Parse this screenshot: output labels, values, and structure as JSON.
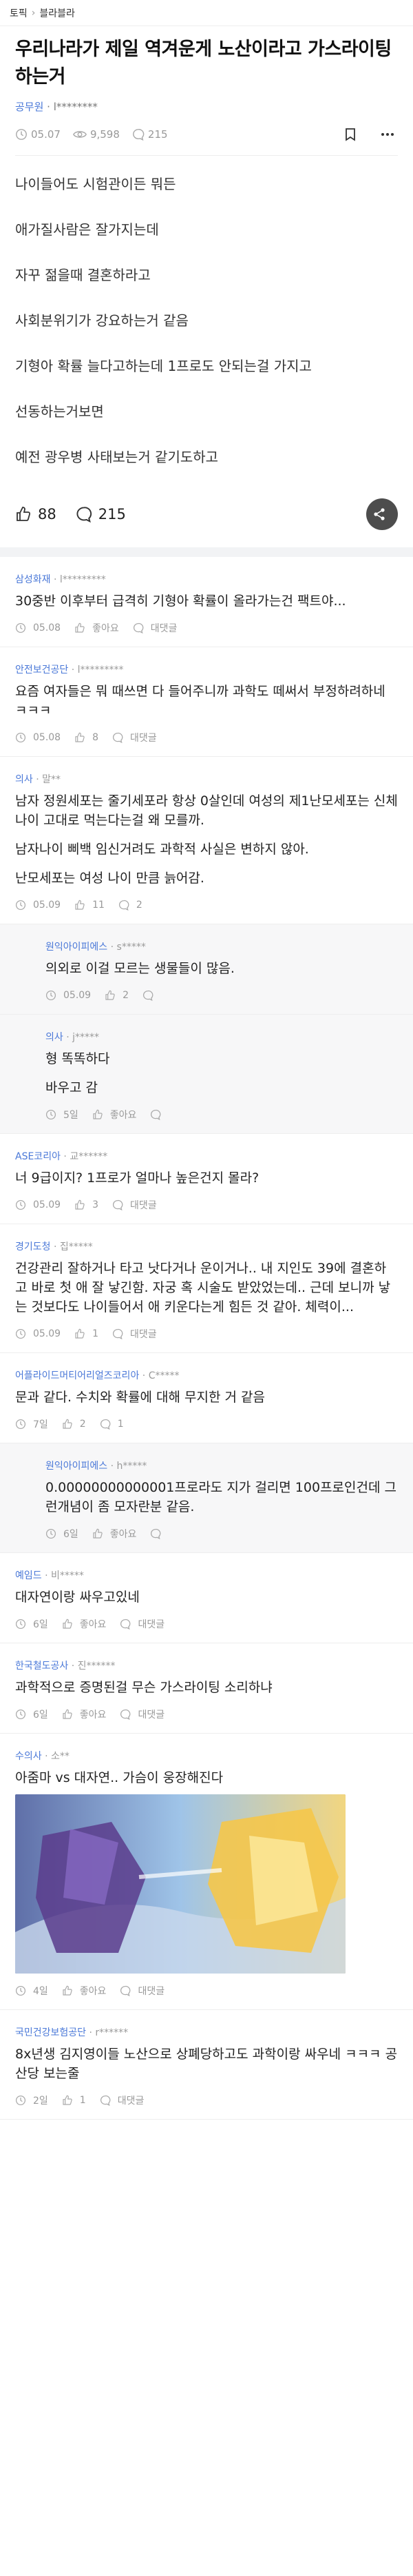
{
  "breadcrumb": {
    "root": "토픽",
    "sep": "›",
    "board": "블라블라"
  },
  "post": {
    "title": "우리나라가 제일 역겨운게 노산이라고 가스라이팅하는거",
    "author_company": "공무원",
    "author_sep": " · ",
    "author_name": "l********",
    "date": "05.07",
    "views": "9,598",
    "comments": "215",
    "body": [
      "나이들어도 시험관이든 뭐든",
      "애가질사람은 잘가지는데",
      "자꾸 젊을때 결혼하라고",
      "사회분위기가 강요하는거 같음",
      "기형아 확률 늘다고하는데 1프로도 안되는걸 가지고",
      "선동하는거보면",
      "예전 광우병 사태보는거 같기도하고"
    ],
    "likes": "88",
    "comment_count": "215"
  },
  "labels": {
    "like": "좋아요",
    "reply": "대댓글"
  },
  "comments": [
    {
      "company": "삼성화재",
      "name": "l*********",
      "text": [
        "30중반 이후부터 급격히 기형아 확률이 올라가는건 팩트야..."
      ],
      "date": "05.08",
      "likes": "좋아요",
      "replies": "대댓글",
      "reply": false
    },
    {
      "company": "안전보건공단",
      "name": "l*********",
      "text": [
        "요즘 여자들은 뭐 때쓰면 다 들어주니까 과학도 떼써서 부정하려하네 ㅋㅋㅋ"
      ],
      "date": "05.08",
      "likes": "8",
      "replies": "대댓글",
      "reply": false
    },
    {
      "company": "의사",
      "name": "말**",
      "text": [
        "남자 정원세포는 줄기세포라 항상 0살인데 여성의 제1난모세포는 신체나이 고대로 먹는다는걸 왜 모를까.",
        "남자나이 삐백 임신거려도 과학적 사실은 변하지 않아.",
        "난모세포는 여성 나이 만큼 늙어감."
      ],
      "date": "05.09",
      "likes": "11",
      "replies": "2",
      "reply": false
    },
    {
      "company": "원익아이피에스",
      "name": "s*****",
      "text": [
        "의외로 이걸 모르는 생물들이 많음."
      ],
      "date": "05.09",
      "likes": "2",
      "replies": "",
      "reply": true
    },
    {
      "company": "의사",
      "name": "j*****",
      "text": [
        "형 똑똑하다",
        "바우고 감"
      ],
      "date": "5일",
      "likes": "좋아요",
      "replies": "",
      "reply": true
    },
    {
      "company": "ASE코리아",
      "name": "교******",
      "text": [
        "너 9급이지? 1프로가 얼마나 높은건지 몰라?"
      ],
      "date": "05.09",
      "likes": "3",
      "replies": "대댓글",
      "reply": false
    },
    {
      "company": "경기도청",
      "name": "집*****",
      "text": [
        "건강관리 잘하거나 타고 낫다거나 운이거나.. 내 지인도 39에 결혼하고 바로 첫 애 잘 낳긴함. 자궁 혹 시술도 받았었는데.. 근데 보니까 낳는 것보다도 나이들어서 애 키운다는게 힘든 것 같아. 체력이..."
      ],
      "date": "05.09",
      "likes": "1",
      "replies": "대댓글",
      "reply": false
    },
    {
      "company": "어플라이드머티어리얼즈코리아",
      "name": "C*****",
      "text": [
        "문과 같다. 수치와 확률에 대해 무지한 거 같음"
      ],
      "date": "7일",
      "likes": "2",
      "replies": "1",
      "reply": false
    },
    {
      "company": "원익아이피에스",
      "name": "h*****",
      "text": [
        "0.00000000000001프로라도 지가 걸리면 100프로인건데 그런개념이 좀 모자란분 같음."
      ],
      "date": "6일",
      "likes": "좋아요",
      "replies": "",
      "reply": true
    },
    {
      "company": "예임드",
      "name": "비*****",
      "text": [
        "대자연이랑 싸우고있네"
      ],
      "date": "6일",
      "likes": "좋아요",
      "replies": "대댓글",
      "reply": false
    },
    {
      "company": "한국철도공사",
      "name": "진******",
      "text": [
        "과학적으로 증명된걸 무슨 가스라이팅 소리하냐"
      ],
      "date": "6일",
      "likes": "좋아요",
      "replies": "대댓글",
      "reply": false
    },
    {
      "company": "수의사",
      "name": "소**",
      "text": [
        "아줌마 vs 대자연.. 가슴이 웅장해진다"
      ],
      "date": "4일",
      "likes": "좋아요",
      "replies": "대댓글",
      "reply": false,
      "image": true
    },
    {
      "company": "국민건강보험공단",
      "name": "r******",
      "text": [
        "8x년생 김지영이들 노산으로 상폐당하고도 과학이랑 싸우네 ㅋㅋㅋ 공산당 보는줄"
      ],
      "date": "2일",
      "likes": "1",
      "replies": "대댓글",
      "reply": false
    }
  ],
  "colors": {
    "accent": "#4a78d8",
    "muted": "#999999",
    "share": "#4d4d4d"
  }
}
